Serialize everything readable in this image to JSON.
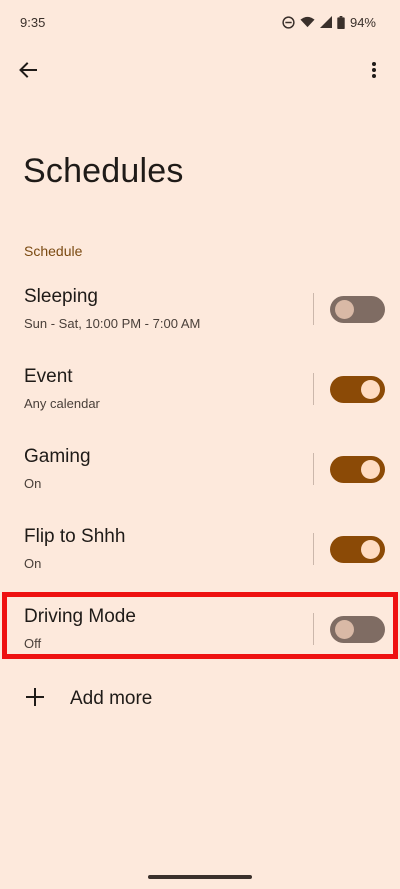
{
  "status_bar": {
    "time": "9:35",
    "battery": "94%",
    "icons": [
      "do-not-disturb-icon",
      "wifi-icon",
      "signal-icon",
      "battery-icon"
    ]
  },
  "toolbar": {
    "back_icon": "arrow-left-icon",
    "more_icon": "more-vertical-icon"
  },
  "page": {
    "title": "Schedules",
    "section_header": "Schedule"
  },
  "schedules": [
    {
      "title": "Sleeping",
      "subtitle": "Sun - Sat, 10:00 PM - 7:00 AM",
      "enabled": false
    },
    {
      "title": "Event",
      "subtitle": "Any calendar",
      "enabled": true
    },
    {
      "title": "Gaming",
      "subtitle": "On",
      "enabled": true
    },
    {
      "title": "Flip to Shhh",
      "subtitle": "On",
      "enabled": true
    },
    {
      "title": "Driving Mode",
      "subtitle": "Off",
      "enabled": false
    }
  ],
  "add_more": {
    "label": "Add more",
    "icon": "plus-icon"
  },
  "colors": {
    "background": "#fde9dc",
    "accent": "#8b4a06",
    "toggle_off": "#7f6c63",
    "highlight": "#ee1111",
    "section_header": "#7a4a12"
  }
}
